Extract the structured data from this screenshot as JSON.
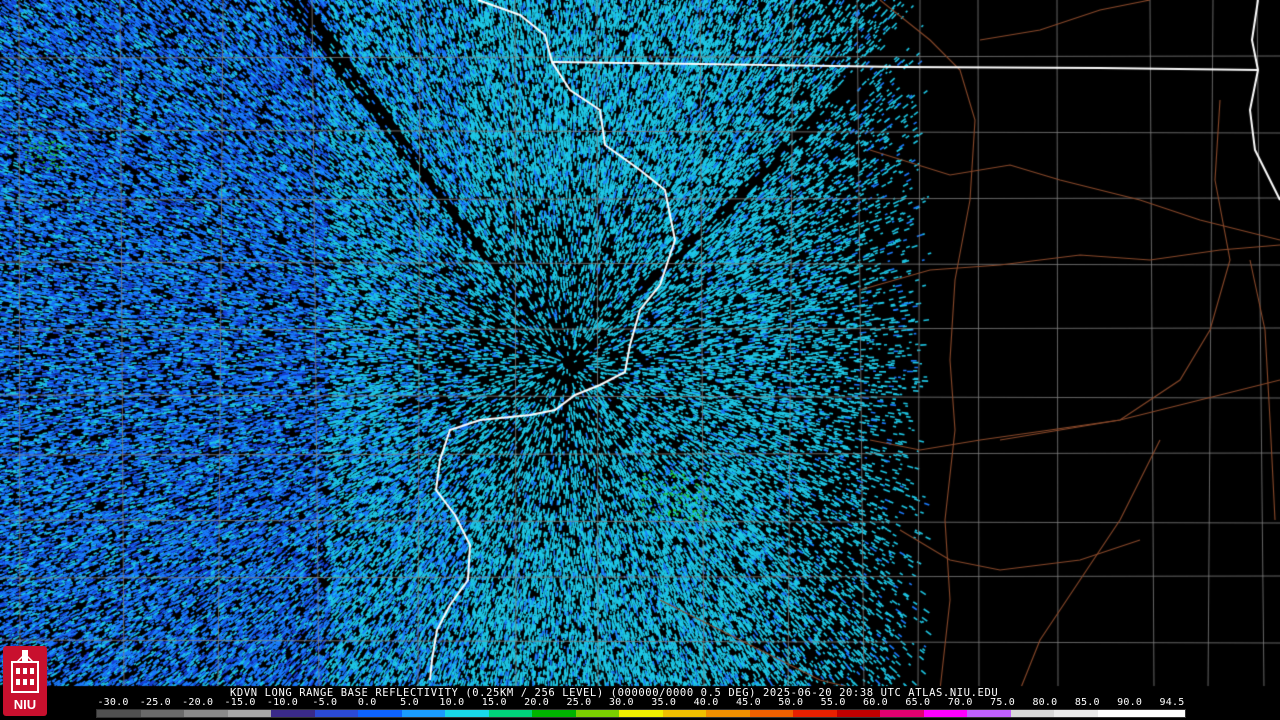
{
  "caption": "KDVN LONG RANGE BASE REFLECTIVITY (0.25KM / 256 LEVEL) (000000/0000 0.5 DEG) 2025-06-20 20:38 UTC  ATLAS.NIU.EDU",
  "logo": {
    "text": "NIU",
    "colors": {
      "background": "#c8102e",
      "seal": "#ffffff"
    }
  },
  "scale": {
    "labels": [
      "-30.0",
      "-25.0",
      "-20.0",
      "-15.0",
      "-10.0",
      "-5.0",
      "0.0",
      "5.0",
      "10.0",
      "15.0",
      "20.0",
      "25.0",
      "30.0",
      "35.0",
      "40.0",
      "45.0",
      "50.0",
      "55.0",
      "60.0",
      "65.0",
      "70.0",
      "75.0",
      "80.0",
      "85.0",
      "90.0",
      "94.5"
    ],
    "colors": [
      "#505050",
      "#6a6a6a",
      "#8a8a8a",
      "#a6a6a6",
      "#3a2a8a",
      "#2b4ad6",
      "#0d63ff",
      "#1a9dff",
      "#18d8e8",
      "#00d27a",
      "#00b400",
      "#7ad000",
      "#f0f000",
      "#f0c000",
      "#f09000",
      "#f06000",
      "#e82000",
      "#c00000",
      "#e00070",
      "#ff00ff",
      "#c060ff",
      "#d8d8d8",
      "#ebebeb",
      "#ffffff",
      "#ffffff"
    ]
  },
  "map_colors": {
    "background": "#000000",
    "state_border": "#ffffff",
    "county_line": "#808080",
    "highway": "#8b4a2b",
    "echo_light": "#1ec8e6",
    "echo_mid": "#1a7cff",
    "echo_dark": "#1540d8",
    "echo_green": "#1fbf3a"
  },
  "radar_site": "KDVN"
}
